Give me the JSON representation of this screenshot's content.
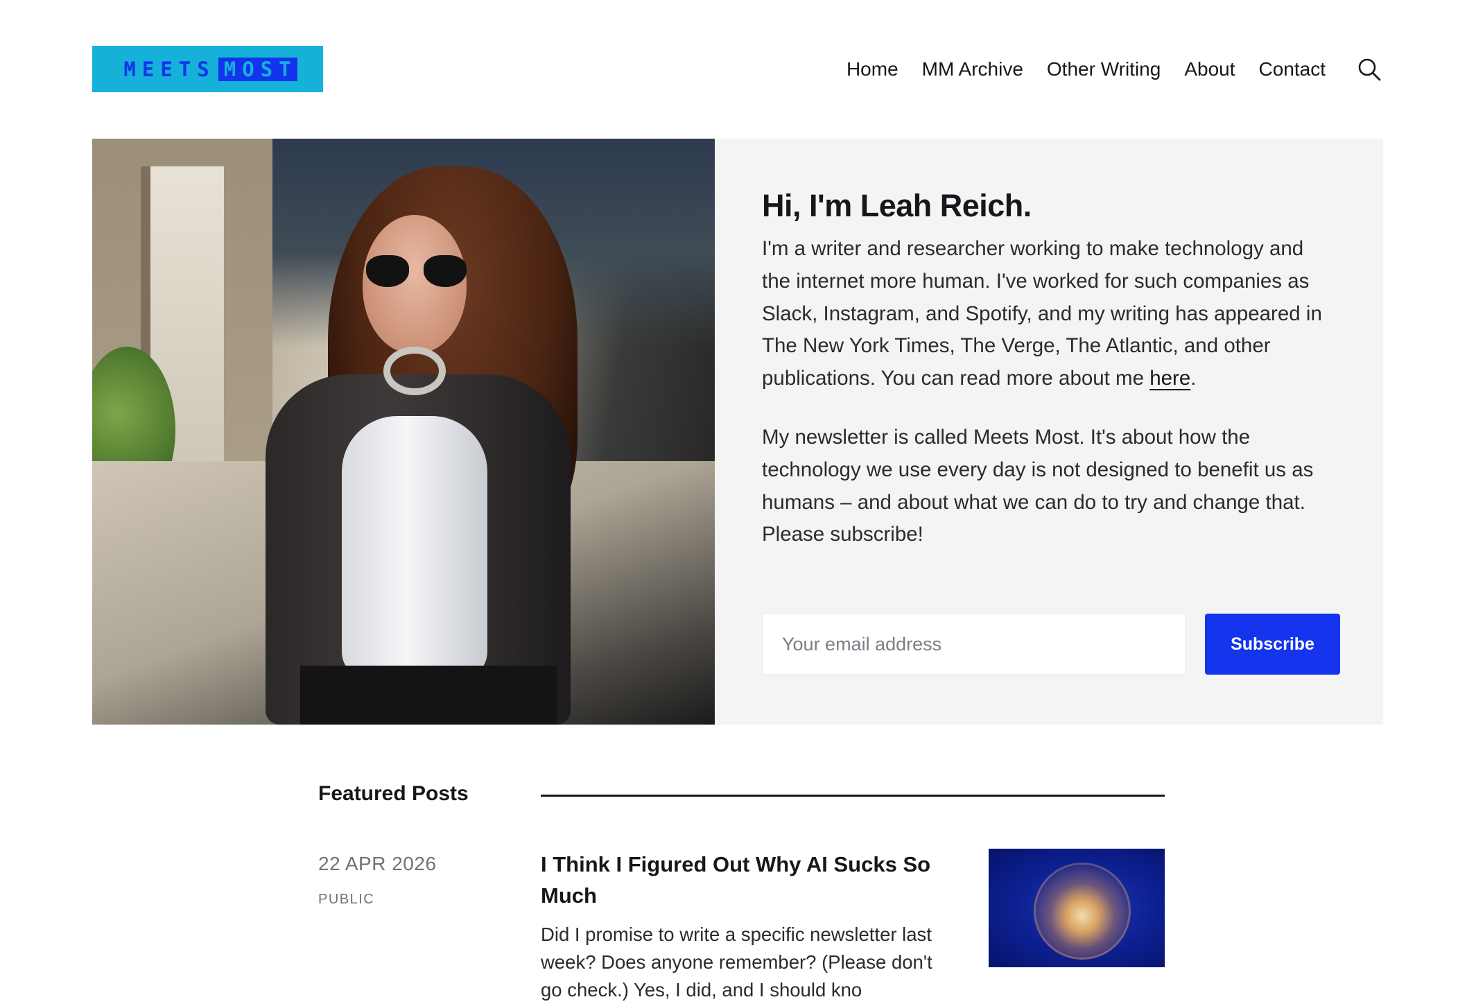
{
  "header": {
    "logo_word_1": "MEETS",
    "logo_word_2": "MOST",
    "nav": [
      "Home",
      "MM Archive",
      "Other Writing",
      "About",
      "Contact"
    ],
    "search_icon": "search-icon"
  },
  "hero": {
    "photo_alt": "Portrait of Leah Reich",
    "title": "Hi, I'm Leah Reich.",
    "intro_before_link": "I'm a writer and researcher working to make technology and the internet more human. I've worked for such companies as Slack, Instagram, and Spotify, and my writing has appeared in The New York Times, The Verge, The Atlantic, and other publications. You can read more about me ",
    "intro_link": "here",
    "intro_after_link": ".",
    "newsletter": "My newsletter is called Meets Most. It's about how the technology we use every day is not designed to benefit us as humans – and about what we can do to try and change that. Please subscribe!",
    "email_placeholder": "Your email address",
    "subscribe_label": "Subscribe"
  },
  "featured": {
    "label": "Featured Posts",
    "posts": [
      {
        "date": "22 APR 2026",
        "visibility": "PUBLIC",
        "title": "I Think I Figured Out Why AI Sucks So Much",
        "excerpt": "Did I promise to write a specific newsletter last week? Does anyone remember? (Please don't go check.) Yes, I did, and I should kno"
      }
    ]
  },
  "colors": {
    "logo_bg": "#15b1d8",
    "logo_text": "#1234ee",
    "accent": "#1434ee",
    "hero_bg": "#f4f4f4"
  }
}
